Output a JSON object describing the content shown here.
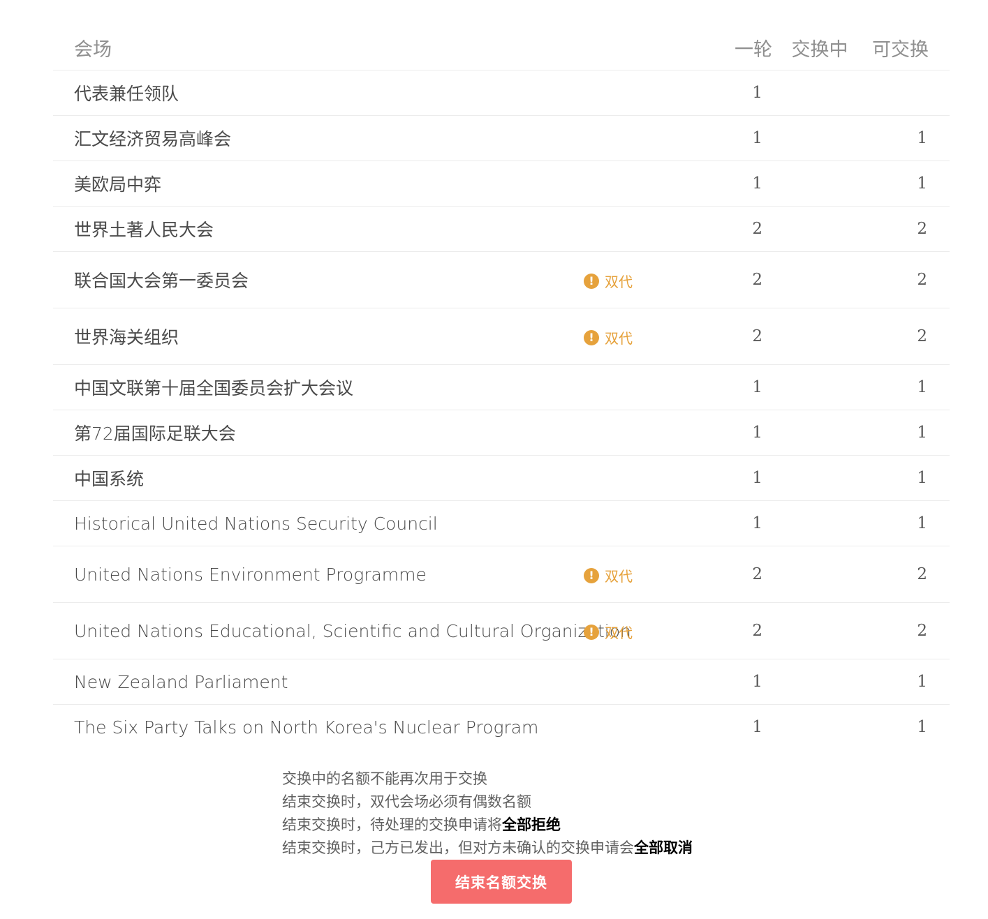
{
  "table": {
    "headers": {
      "venue": "会场",
      "round_one": "一轮",
      "exchanging": "交换中",
      "exchangeable": "可交换"
    },
    "double_label": "双代",
    "rows": [
      {
        "venue": "代表兼任领队",
        "double": false,
        "round_one": "1",
        "exchanging": "",
        "exchangeable": ""
      },
      {
        "venue": "汇文经济贸易高峰会",
        "double": false,
        "round_one": "1",
        "exchanging": "",
        "exchangeable": "1"
      },
      {
        "venue": "美欧局中弈",
        "double": false,
        "round_one": "1",
        "exchanging": "",
        "exchangeable": "1"
      },
      {
        "venue": "世界土著人民大会",
        "double": false,
        "round_one": "2",
        "exchanging": "",
        "exchangeable": "2"
      },
      {
        "venue": "联合国大会第一委员会",
        "double": true,
        "round_one": "2",
        "exchanging": "",
        "exchangeable": "2"
      },
      {
        "venue": "世界海关组织",
        "double": true,
        "round_one": "2",
        "exchanging": "",
        "exchangeable": "2"
      },
      {
        "venue": "中国文联第十届全国委员会扩大会议",
        "double": false,
        "round_one": "1",
        "exchanging": "",
        "exchangeable": "1"
      },
      {
        "venue": "第72届国际足联大会",
        "double": false,
        "round_one": "1",
        "exchanging": "",
        "exchangeable": "1"
      },
      {
        "venue": "中国系统",
        "double": false,
        "round_one": "1",
        "exchanging": "",
        "exchangeable": "1"
      },
      {
        "venue": "Historical United Nations Security Council",
        "double": false,
        "round_one": "1",
        "exchanging": "",
        "exchangeable": "1"
      },
      {
        "venue": "United Nations Environment Programme",
        "double": true,
        "round_one": "2",
        "exchanging": "",
        "exchangeable": "2"
      },
      {
        "venue": "United Nations Educational, Scientific and Cultural Organization",
        "double": true,
        "round_one": "2",
        "exchanging": "",
        "exchangeable": "2"
      },
      {
        "venue": "New Zealand Parliament",
        "double": false,
        "round_one": "1",
        "exchanging": "",
        "exchangeable": "1"
      },
      {
        "venue": "The Six Party Talks on North Korea's Nuclear Program",
        "double": false,
        "round_one": "1",
        "exchanging": "",
        "exchangeable": "1"
      }
    ]
  },
  "notes": {
    "line1": "交换中的名额不能再次用于交换",
    "line2": "结束交换时，双代会场必须有偶数名额",
    "line3_text": "结束交换时，待处理的交换申请将",
    "line3_bold": "全部拒绝",
    "line4_text": "结束交换时，己方已发出，但对方未确认的交换申请会",
    "line4_bold": "全部取消"
  },
  "actions": {
    "end_exchange_label": "结束名额交换"
  },
  "colors": {
    "warning": "#e6a23c",
    "danger_button": "#f56c6c",
    "divider": "#ececec",
    "header_text": "#8f8f8f"
  },
  "icons": {
    "double_badge_icon": "exclamation-circle-icon"
  }
}
